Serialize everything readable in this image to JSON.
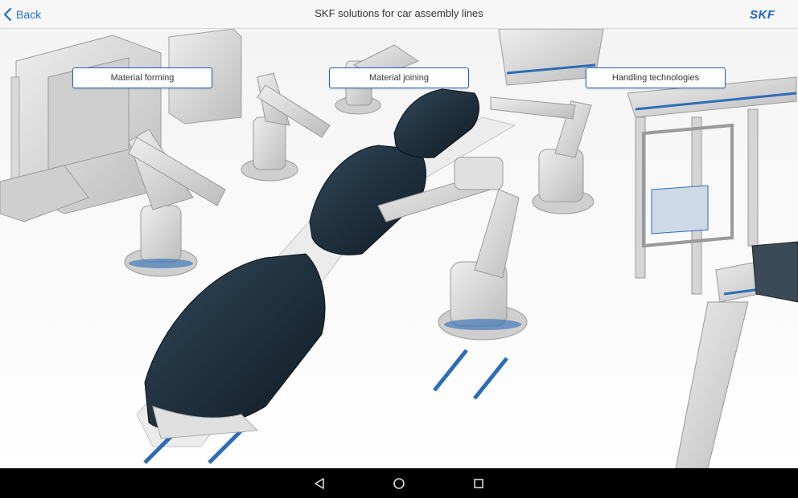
{
  "header": {
    "back_label": "Back",
    "title": "SKF solutions for car assembly lines",
    "logo_text": "SKF"
  },
  "hotspots": [
    {
      "label": "Material forming"
    },
    {
      "label": "Material joining"
    },
    {
      "label": "Handling technologies"
    }
  ],
  "colors": {
    "accent": "#1f6fd0",
    "rail": "#2c6db5",
    "car_body": "#1c2b36",
    "machine": "#d9d9d9"
  },
  "navbar": {
    "icons": [
      "back-triangle-icon",
      "home-circle-icon",
      "recents-square-icon"
    ]
  }
}
